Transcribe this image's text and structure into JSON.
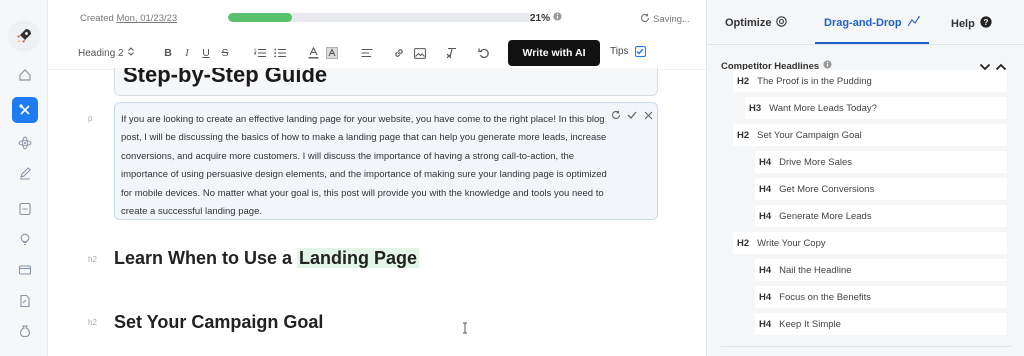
{
  "status": {
    "created_label": "Created",
    "created_date": "Mon, 01/23/23",
    "progress_percent": 21,
    "progress_text": "21%",
    "saving_text": "Saving..."
  },
  "toolbar": {
    "heading_select": "Heading 2",
    "write_ai_label": "Write with AI",
    "tips_label": "Tips",
    "tips_checked": true
  },
  "editor": {
    "h1_text": "Step-by-Step Guide",
    "p_label": "p",
    "paragraph": "If you are looking to create an effective landing page for your website, you have come to the right place! In this blog post, I will be discussing the basics of how to make a landing page that can help you generate more leads, increase conversions, and acquire more customers. I will discuss the importance of having a strong call-to-action, the importance of using persuasive design elements, and the importance of making sure your landing page is optimized for mobile devices. No matter what your goal is, this post will provide you with the knowledge and tools you need to create a successful landing page.",
    "h2_label": "h2",
    "h2_a_prefix": "Learn When to Use a ",
    "h2_a_highlight": "Landing Page",
    "h2_b": "Set Your Campaign Goal"
  },
  "panel": {
    "tabs": [
      "Optimize",
      "Drag-and-Drop",
      "Help"
    ],
    "active_tab": "Drag-and-Drop",
    "section_title": "Competitor Headlines",
    "headlines": [
      {
        "level": "H2",
        "text": "The Proof is in the Pudding"
      },
      {
        "level": "H3",
        "text": "Want More Leads Today?"
      },
      {
        "level": "H2",
        "text": "Set Your Campaign Goal"
      },
      {
        "level": "H4",
        "text": "Drive More Sales"
      },
      {
        "level": "H4",
        "text": "Get More Conversions"
      },
      {
        "level": "H4",
        "text": "Generate More Leads"
      },
      {
        "level": "H2",
        "text": "Write Your Copy"
      },
      {
        "level": "H4",
        "text": "Nail the Headline"
      },
      {
        "level": "H4",
        "text": "Focus on the Benefits"
      },
      {
        "level": "H4",
        "text": "Keep It Simple"
      }
    ]
  },
  "colors": {
    "accent": "#1f7bf2",
    "progress": "#58c16b",
    "highlight": "#e3f5e6",
    "active_tab": "#1f62c7"
  }
}
